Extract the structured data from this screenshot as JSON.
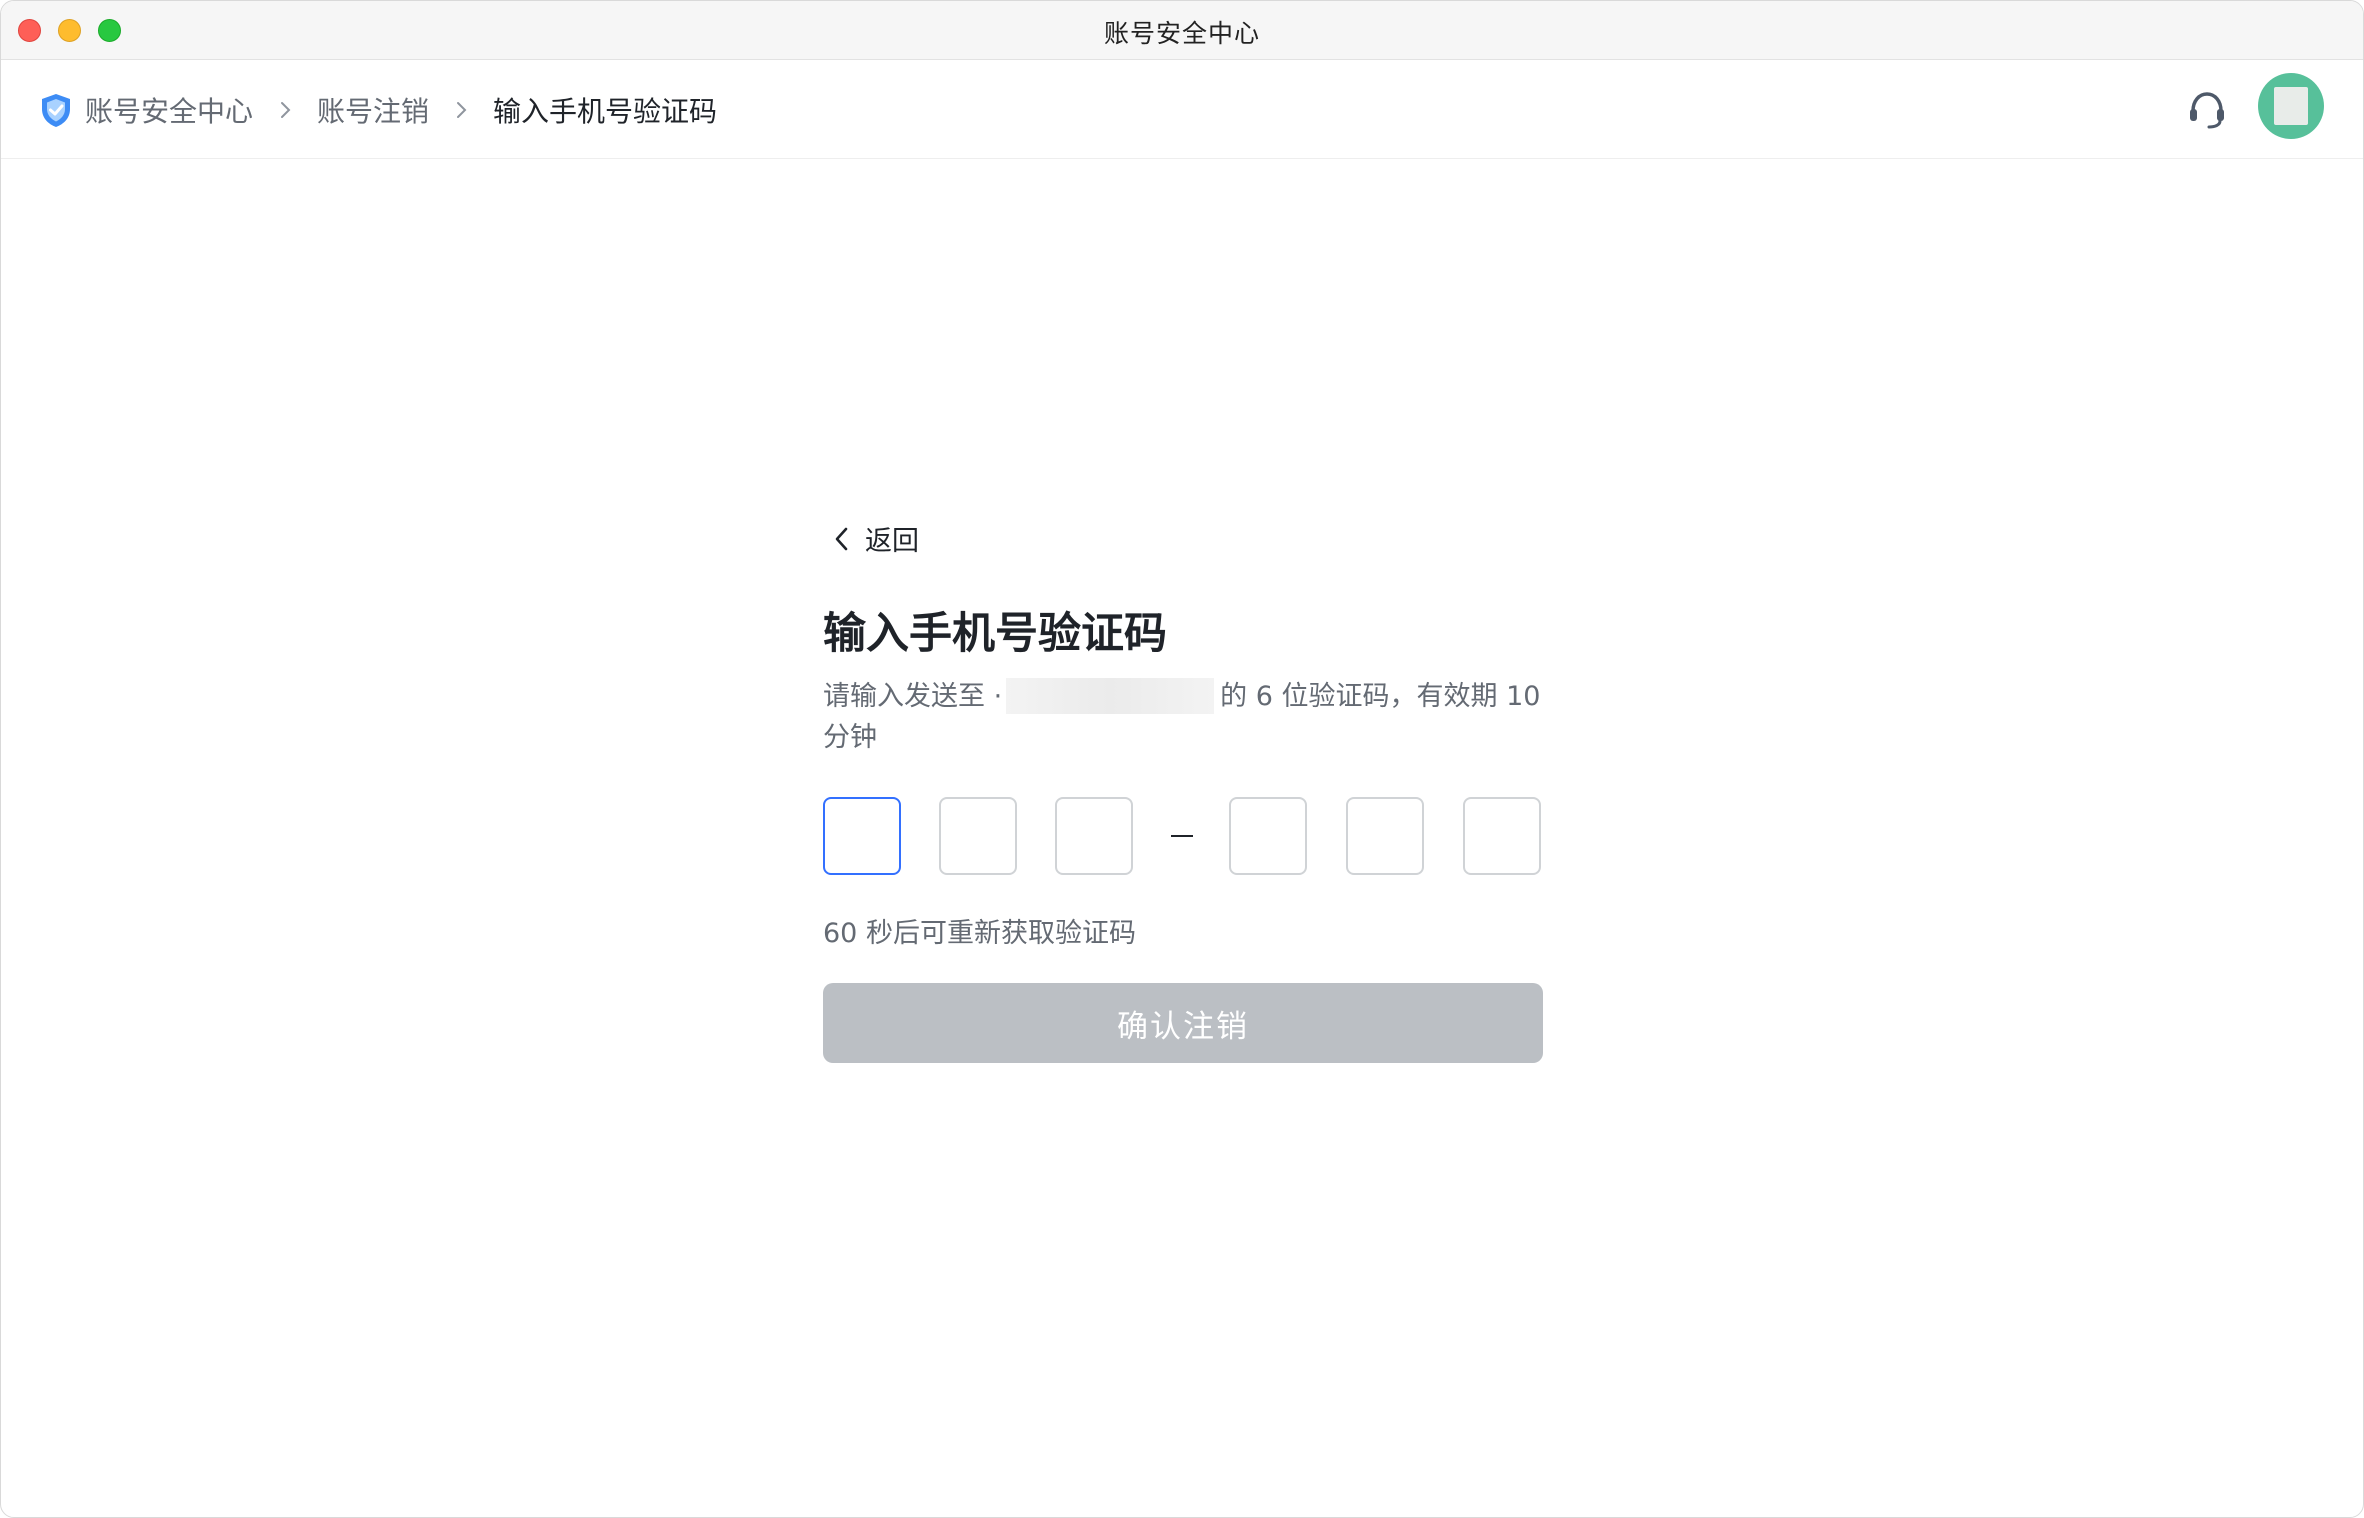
{
  "window": {
    "title": "账号安全中心"
  },
  "breadcrumb": {
    "items": [
      {
        "label": "账号安全中心"
      },
      {
        "label": "账号注销"
      },
      {
        "label": "输入手机号验证码"
      }
    ]
  },
  "header": {
    "support_icon": "headset-icon",
    "avatar_icon": "avatar"
  },
  "main": {
    "back_label": "返回",
    "title": "输入手机号验证码",
    "desc_prefix": "请输入发送至 ·",
    "desc_suffix": "的 6 位验证码，有效期 10 分钟",
    "code_digits": [
      "",
      "",
      "",
      "",
      "",
      ""
    ],
    "countdown": "60 秒后可重新获取验证码",
    "confirm_label": "确认注销"
  },
  "colors": {
    "accent": "#3370ff",
    "button_disabled": "#bbbfc4",
    "avatar": "#57c09a",
    "shield": "#3d8cf5"
  }
}
